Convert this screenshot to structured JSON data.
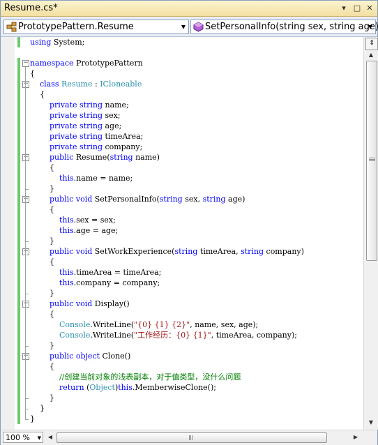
{
  "window": {
    "title": "Resume.cs*",
    "controls": {
      "dropdown": "▾",
      "maximize": "□",
      "close": "✕"
    }
  },
  "nav": {
    "type_combo": "PrototypePattern.Resume",
    "member_combo": "SetPersonalInfo(string sex, string age)",
    "type_icon": "class-icon",
    "member_icon": "method-icon"
  },
  "colors": {
    "keyword": "#0000ff",
    "type": "#2b91af",
    "string": "#a31515",
    "comment": "#008000",
    "change_bar": "#6ec86e"
  },
  "code_lines": [
    [
      [
        "kw",
        "using"
      ],
      [
        "t",
        " System;"
      ]
    ],
    [],
    [
      [
        "kw",
        "namespace"
      ],
      [
        "t",
        " PrototypePattern"
      ]
    ],
    [
      [
        "t",
        "{"
      ]
    ],
    [
      [
        "t",
        "    "
      ],
      [
        "kw",
        "class"
      ],
      [
        "t",
        " "
      ],
      [
        "ty",
        "Resume"
      ],
      [
        "t",
        " : "
      ],
      [
        "ty",
        "ICloneable"
      ]
    ],
    [
      [
        "t",
        "    {"
      ]
    ],
    [
      [
        "t",
        "        "
      ],
      [
        "kw",
        "private"
      ],
      [
        "t",
        " "
      ],
      [
        "kw",
        "string"
      ],
      [
        "t",
        " name;"
      ]
    ],
    [
      [
        "t",
        "        "
      ],
      [
        "kw",
        "private"
      ],
      [
        "t",
        " "
      ],
      [
        "kw",
        "string"
      ],
      [
        "t",
        " sex;"
      ]
    ],
    [
      [
        "t",
        "        "
      ],
      [
        "kw",
        "private"
      ],
      [
        "t",
        " "
      ],
      [
        "kw",
        "string"
      ],
      [
        "t",
        " age;"
      ]
    ],
    [
      [
        "t",
        "        "
      ],
      [
        "kw",
        "private"
      ],
      [
        "t",
        " "
      ],
      [
        "kw",
        "string"
      ],
      [
        "t",
        " timeArea;"
      ]
    ],
    [
      [
        "t",
        "        "
      ],
      [
        "kw",
        "private"
      ],
      [
        "t",
        " "
      ],
      [
        "kw",
        "string"
      ],
      [
        "t",
        " company;"
      ]
    ],
    [
      [
        "t",
        "        "
      ],
      [
        "kw",
        "public"
      ],
      [
        "t",
        " Resume("
      ],
      [
        "kw",
        "string"
      ],
      [
        "t",
        " name)"
      ]
    ],
    [
      [
        "t",
        "        {"
      ]
    ],
    [
      [
        "t",
        "            "
      ],
      [
        "kw",
        "this"
      ],
      [
        "t",
        ".name = name;"
      ]
    ],
    [
      [
        "t",
        "        }"
      ]
    ],
    [
      [
        "t",
        "        "
      ],
      [
        "kw",
        "public"
      ],
      [
        "t",
        " "
      ],
      [
        "kw",
        "void"
      ],
      [
        "t",
        " SetPersonalInfo("
      ],
      [
        "kw",
        "string"
      ],
      [
        "t",
        " sex, "
      ],
      [
        "kw",
        "string"
      ],
      [
        "t",
        " age)"
      ]
    ],
    [
      [
        "t",
        "        {"
      ]
    ],
    [
      [
        "t",
        "            "
      ],
      [
        "kw",
        "this"
      ],
      [
        "t",
        ".sex = sex;"
      ]
    ],
    [
      [
        "t",
        "            "
      ],
      [
        "kw",
        "this"
      ],
      [
        "t",
        ".age = age;"
      ]
    ],
    [
      [
        "t",
        "        }"
      ]
    ],
    [
      [
        "t",
        "        "
      ],
      [
        "kw",
        "public"
      ],
      [
        "t",
        " "
      ],
      [
        "kw",
        "void"
      ],
      [
        "t",
        " SetWorkExperience("
      ],
      [
        "kw",
        "string"
      ],
      [
        "t",
        " timeArea, "
      ],
      [
        "kw",
        "string"
      ],
      [
        "t",
        " company)"
      ]
    ],
    [
      [
        "t",
        "        {"
      ]
    ],
    [
      [
        "t",
        "            "
      ],
      [
        "kw",
        "this"
      ],
      [
        "t",
        ".timeArea = timeArea;"
      ]
    ],
    [
      [
        "t",
        "            "
      ],
      [
        "kw",
        "this"
      ],
      [
        "t",
        ".company = company;"
      ]
    ],
    [
      [
        "t",
        "        }"
      ]
    ],
    [
      [
        "t",
        "        "
      ],
      [
        "kw",
        "public"
      ],
      [
        "t",
        " "
      ],
      [
        "kw",
        "void"
      ],
      [
        "t",
        " Display()"
      ]
    ],
    [
      [
        "t",
        "        {"
      ]
    ],
    [
      [
        "t",
        "            "
      ],
      [
        "ty",
        "Console"
      ],
      [
        "t",
        ".WriteLine("
      ],
      [
        "st",
        "\"{0} {1} {2}\""
      ],
      [
        "t",
        ", name, sex, age);"
      ]
    ],
    [
      [
        "t",
        "            "
      ],
      [
        "ty",
        "Console"
      ],
      [
        "t",
        ".WriteLine("
      ],
      [
        "st",
        "\"工作经历：{0} {1}\""
      ],
      [
        "t",
        ", timeArea, company);"
      ]
    ],
    [
      [
        "t",
        "        }"
      ]
    ],
    [
      [
        "t",
        "        "
      ],
      [
        "kw",
        "public"
      ],
      [
        "t",
        " "
      ],
      [
        "kw",
        "object"
      ],
      [
        "t",
        " Clone()"
      ]
    ],
    [
      [
        "t",
        "        {"
      ]
    ],
    [
      [
        "t",
        "            "
      ],
      [
        "cm",
        "//创建当前对象的浅表副本，对于值类型，没什么问题"
      ]
    ],
    [
      [
        "t",
        "            "
      ],
      [
        "kw",
        "return"
      ],
      [
        "t",
        " ("
      ],
      [
        "ty",
        "Object"
      ],
      [
        "t",
        ")"
      ],
      [
        "kw",
        "this"
      ],
      [
        "t",
        ".MemberwiseClone();"
      ]
    ],
    [
      [
        "t",
        "        }"
      ]
    ],
    [
      [
        "t",
        "    }"
      ]
    ],
    [
      [
        "t",
        "}"
      ]
    ]
  ],
  "statusbar": {
    "zoom": "100 %"
  }
}
